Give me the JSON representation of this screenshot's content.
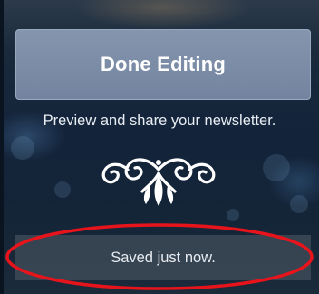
{
  "panel": {
    "done_button_label": "Done Editing",
    "hint_text": "Preview and share your newsletter.",
    "ornament_icon": "flourish-ornament-icon",
    "status_text": "Saved just now."
  },
  "annotation": {
    "highlight_color": "#e8141c"
  },
  "colors": {
    "button_bg": "#7a8aa4",
    "panel_bg": "#142538",
    "status_bg": "#3a4654"
  }
}
